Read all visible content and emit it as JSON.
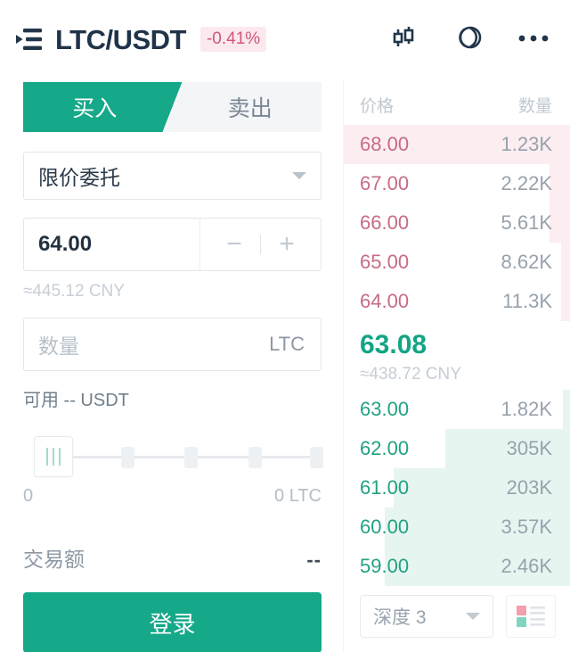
{
  "header": {
    "menu_icon": "list-arrow-icon",
    "pair": "LTC/USDT",
    "change": "-0.41%",
    "change_color": "#d1567a",
    "change_bg": "#fbe9ee",
    "icons": [
      "candlestick-chart-icon",
      "coins-overlap-icon",
      "more-dots-icon"
    ]
  },
  "trade": {
    "tabs": {
      "buy": "买入",
      "sell": "卖出",
      "active": "buy"
    },
    "order_type": "限价委托",
    "price": {
      "value": "64.00",
      "minus": "−",
      "plus": "+",
      "cny": "≈445.12 CNY"
    },
    "amount": {
      "placeholder": "数量",
      "unit": "LTC"
    },
    "available": "可用 -- USDT",
    "slider": {
      "min_label": "0",
      "max_label": "0 LTC",
      "value": 0
    },
    "total": {
      "label": "交易额",
      "value": "--"
    },
    "submit": "登录",
    "accent_color": "#15a889"
  },
  "orderbook": {
    "col_price": "价格",
    "col_qty": "数量",
    "asks": [
      {
        "price": "68.00",
        "qty": "1.23K",
        "depth": 100
      },
      {
        "price": "67.00",
        "qty": "2.22K",
        "depth": 9
      },
      {
        "price": "66.00",
        "qty": "5.61K",
        "depth": 9
      },
      {
        "price": "65.00",
        "qty": "8.62K",
        "depth": 4
      },
      {
        "price": "64.00",
        "qty": "11.3K",
        "depth": 4
      }
    ],
    "last": {
      "price": "63.08",
      "cny": "≈438.72 CNY",
      "color": "#12a585"
    },
    "bids": [
      {
        "price": "63.00",
        "qty": "1.82K",
        "depth": 3
      },
      {
        "price": "62.00",
        "qty": "305K",
        "depth": 55
      },
      {
        "price": "61.00",
        "qty": "203K",
        "depth": 78
      },
      {
        "price": "60.00",
        "qty": "3.57K",
        "depth": 82
      },
      {
        "price": "59.00",
        "qty": "2.46K",
        "depth": 82
      }
    ],
    "footer": {
      "depth_select": "深度 3",
      "view_toggle_icon": "depth-list-view-icon"
    },
    "ask_color": "#c76b83",
    "bid_color": "#21a183"
  }
}
